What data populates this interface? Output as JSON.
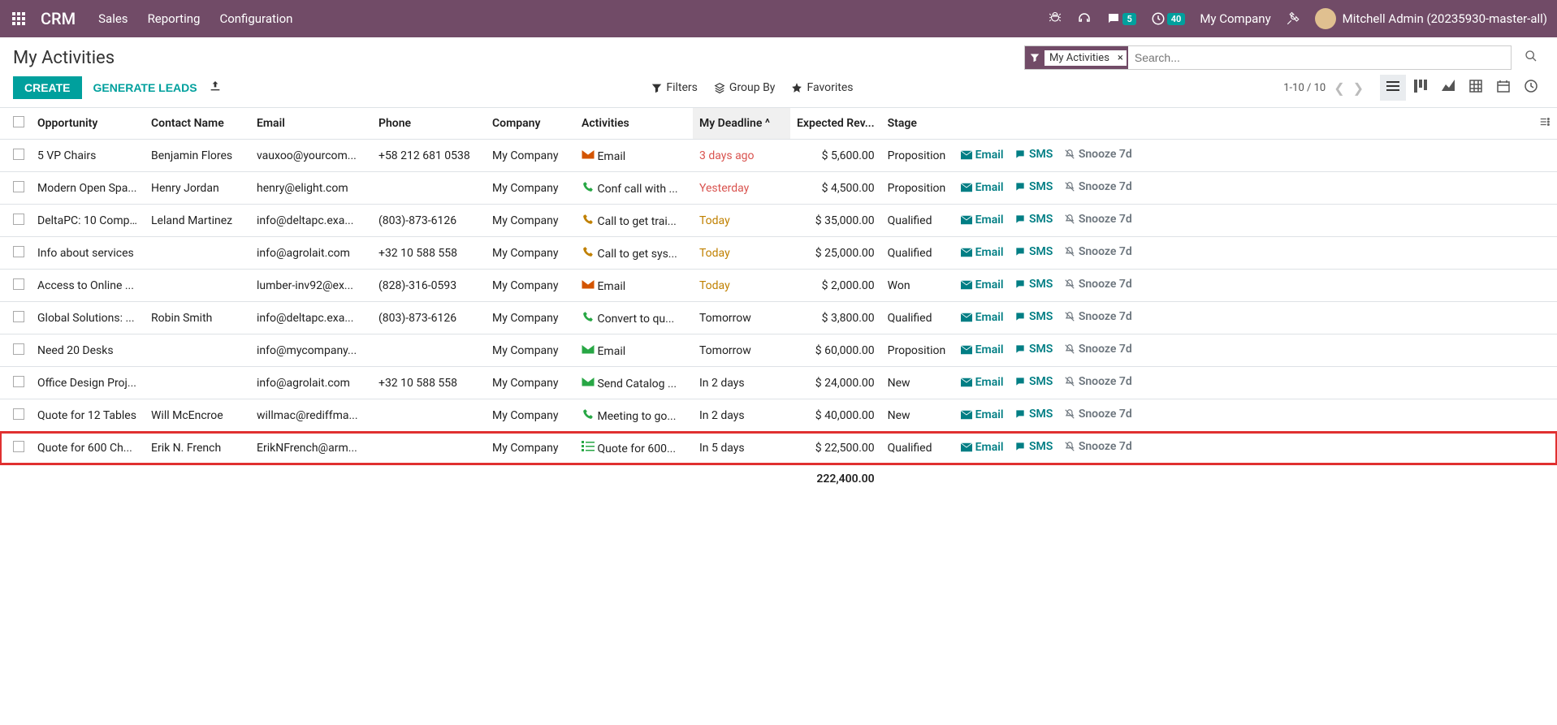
{
  "brand": "CRM",
  "top_menu": [
    "Sales",
    "Reporting",
    "Configuration"
  ],
  "msg_badge": "5",
  "clock_badge": "40",
  "company_label": "My Company",
  "user_label": "Mitchell Admin (20235930-master-all)",
  "page_title": "My Activities",
  "search": {
    "facet_label": "My Activities",
    "placeholder": "Search..."
  },
  "buttons": {
    "create": "CREATE",
    "generate": "GENERATE LEADS"
  },
  "toolbar": {
    "filters": "Filters",
    "group_by": "Group By",
    "favorites": "Favorites"
  },
  "pager": {
    "range": "1-10 / 10"
  },
  "columns": {
    "opportunity": "Opportunity",
    "contact": "Contact Name",
    "email": "Email",
    "phone": "Phone",
    "company": "Company",
    "activities": "Activities",
    "deadline": "My Deadline",
    "expected_rev": "Expected Rev...",
    "stage": "Stage"
  },
  "action_labels": {
    "email": "Email",
    "sms": "SMS",
    "snooze": "Snooze 7d"
  },
  "rows": [
    {
      "opportunity": "5 VP Chairs",
      "contact": "Benjamin Flores",
      "email": "vauxoo@yourcom...",
      "phone": "+58 212 681 0538",
      "company": "My Company",
      "act_icon": "env-orange",
      "activity": "Email",
      "deadline": "3 days ago",
      "dclass": "d-red",
      "rev": "$ 5,600.00",
      "stage": "Proposition",
      "hl": false
    },
    {
      "opportunity": "Modern Open Spa...",
      "contact": "Henry Jordan",
      "email": "henry@elight.com",
      "phone": "",
      "company": "My Company",
      "act_icon": "phone-green",
      "activity": "Conf call with ...",
      "deadline": "Yesterday",
      "dclass": "d-red",
      "rev": "$ 4,500.00",
      "stage": "Proposition",
      "hl": false
    },
    {
      "opportunity": "DeltaPC: 10 Comp...",
      "contact": "Leland Martinez",
      "email": "info@deltapc.exa...",
      "phone": "(803)-873-6126",
      "company": "My Company",
      "act_icon": "phone-orange",
      "activity": "Call to get trai...",
      "deadline": "Today",
      "dclass": "d-orange",
      "rev": "$ 35,000.00",
      "stage": "Qualified",
      "hl": false
    },
    {
      "opportunity": "Info about services",
      "contact": "",
      "email": "info@agrolait.com",
      "phone": "+32 10 588 558",
      "company": "My Company",
      "act_icon": "phone-orange",
      "activity": "Call to get sys...",
      "deadline": "Today",
      "dclass": "d-orange",
      "rev": "$ 25,000.00",
      "stage": "Qualified",
      "hl": false
    },
    {
      "opportunity": "Access to Online ...",
      "contact": "",
      "email": "lumber-inv92@ex...",
      "phone": "(828)-316-0593",
      "company": "My Company",
      "act_icon": "env-orange",
      "activity": "Email",
      "deadline": "Today",
      "dclass": "d-orange",
      "rev": "$ 2,000.00",
      "stage": "Won",
      "hl": false
    },
    {
      "opportunity": "Global Solutions: ...",
      "contact": "Robin Smith",
      "email": "info@deltapc.exa...",
      "phone": "(803)-873-6126",
      "company": "My Company",
      "act_icon": "phone-green",
      "activity": "Convert to qu...",
      "deadline": "Tomorrow",
      "dclass": "",
      "rev": "$ 3,800.00",
      "stage": "Qualified",
      "hl": false
    },
    {
      "opportunity": "Need 20 Desks",
      "contact": "",
      "email": "info@mycompany...",
      "phone": "",
      "company": "My Company",
      "act_icon": "env-green",
      "activity": "Email",
      "deadline": "Tomorrow",
      "dclass": "",
      "rev": "$ 60,000.00",
      "stage": "Proposition",
      "hl": false
    },
    {
      "opportunity": "Office Design Proj...",
      "contact": "",
      "email": "info@agrolait.com",
      "phone": "+32 10 588 558",
      "company": "My Company",
      "act_icon": "env-green",
      "activity": "Send Catalog ...",
      "deadline": "In 2 days",
      "dclass": "",
      "rev": "$ 24,000.00",
      "stage": "New",
      "hl": false
    },
    {
      "opportunity": "Quote for 12 Tables",
      "contact": "Will McEncroe",
      "email": "willmac@rediffma...",
      "phone": "",
      "company": "My Company",
      "act_icon": "phone-green",
      "activity": "Meeting to go...",
      "deadline": "In 2 days",
      "dclass": "",
      "rev": "$ 40,000.00",
      "stage": "New",
      "hl": false
    },
    {
      "opportunity": "Quote for 600 Ch...",
      "contact": "Erik N. French",
      "email": "ErikNFrench@arm...",
      "phone": "",
      "company": "My Company",
      "act_icon": "list-green",
      "activity": "Quote for 600...",
      "deadline": "In 5 days",
      "dclass": "",
      "rev": "$ 22,500.00",
      "stage": "Qualified",
      "hl": true
    }
  ],
  "total_rev": "222,400.00"
}
